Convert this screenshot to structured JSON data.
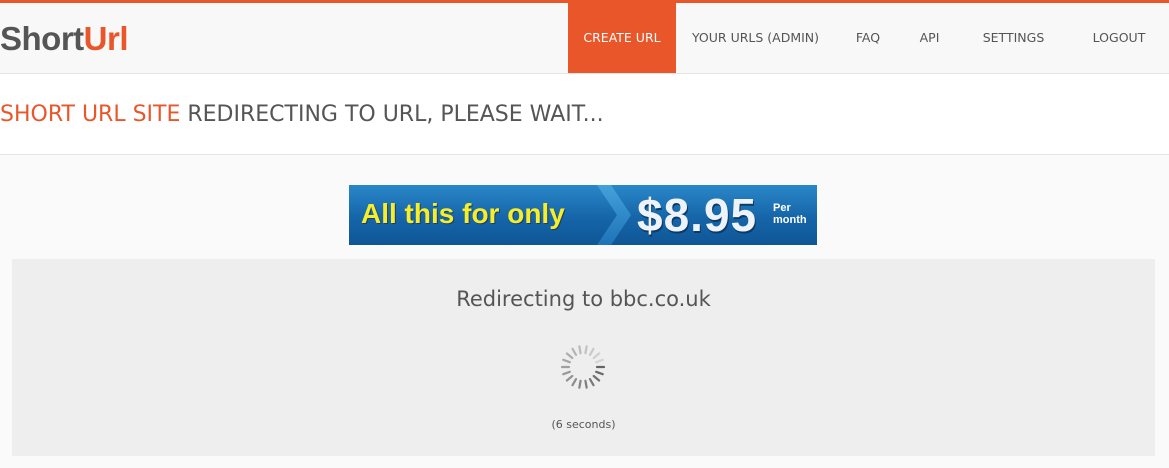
{
  "logo": {
    "part1": "Short",
    "part2": "Url"
  },
  "nav": {
    "create_url": "CREATE URL",
    "your_urls": "YOUR URLS (ADMIN)",
    "faq": "FAQ",
    "api": "API",
    "settings": "SETTINGS",
    "logout": "LOGOUT",
    "active": "create_url"
  },
  "page": {
    "title_site": "SHORT URL SITE",
    "title_message": " REDIRECTING TO URL, PLEASE WAIT..."
  },
  "banner": {
    "text": "All this for only",
    "price": "$8.95",
    "per_line1": "Per",
    "per_line2": "month"
  },
  "redirect": {
    "message": "Redirecting to bbc.co.uk",
    "countdown": "(6 seconds)"
  },
  "colors": {
    "accent": "#e8562a",
    "text": "#555555",
    "banner_yellow": "#f6ee2a",
    "banner_blue": "#1565a8"
  }
}
